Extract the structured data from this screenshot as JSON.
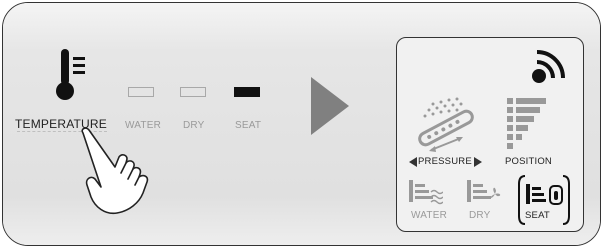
{
  "left_panel": {
    "labels": {
      "temperature": "TEMPERATURE",
      "water": "WATER",
      "dry": "DRY",
      "seat": "SEAT"
    },
    "indicators": [
      {
        "key": "water",
        "state": "off"
      },
      {
        "key": "dry",
        "state": "off"
      },
      {
        "key": "seat",
        "state": "on"
      }
    ],
    "temperature_icon": "thermometer-icon"
  },
  "arrow_icon": "right-arrow-icon",
  "remote": {
    "signal_icon": "wireless-signal-icon",
    "pressure_label": "PRESSURE",
    "position_label": "POSITION",
    "water_label": "WATER",
    "dry_label": "DRY",
    "seat_label": "SEAT"
  },
  "colors": {
    "text_dark": "#222222",
    "text_light": "#9a9a9a",
    "indicator_on": "#111111",
    "panel_bg": "#e4e4e4"
  }
}
